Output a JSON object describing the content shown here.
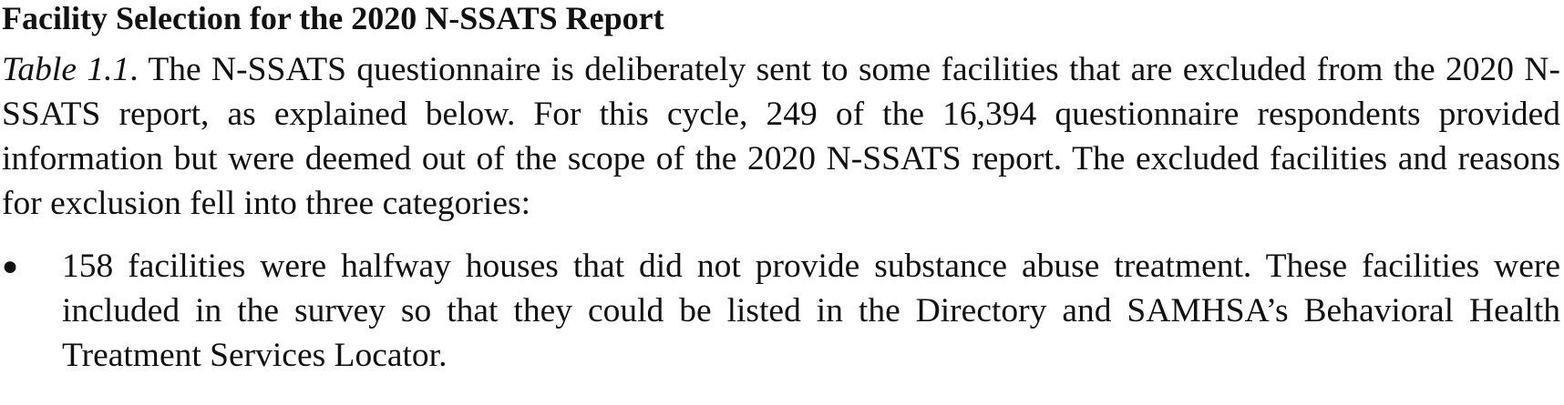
{
  "heading": "Facility Selection for the 2020 N-SSATS Report",
  "intro": {
    "table_ref": "Table 1.1",
    "text": ". The N-SSATS questionnaire is deliberately sent to some facilities that are excluded from the 2020 N-SSATS report, as explained below. For this cycle, 249 of the 16,394 questionnaire respondents provided information but were deemed out of the scope of the 2020 N-SSATS report. The excluded facilities and reasons for exclusion fell into three categories:"
  },
  "bullets": [
    {
      "marker": "●",
      "text": "158 facilities were halfway houses that did not provide substance abuse treatment. These facilities were included in the survey so that they could be listed in the Directory and SAMHSA’s Behavioral Health Treatment Services Locator."
    }
  ]
}
